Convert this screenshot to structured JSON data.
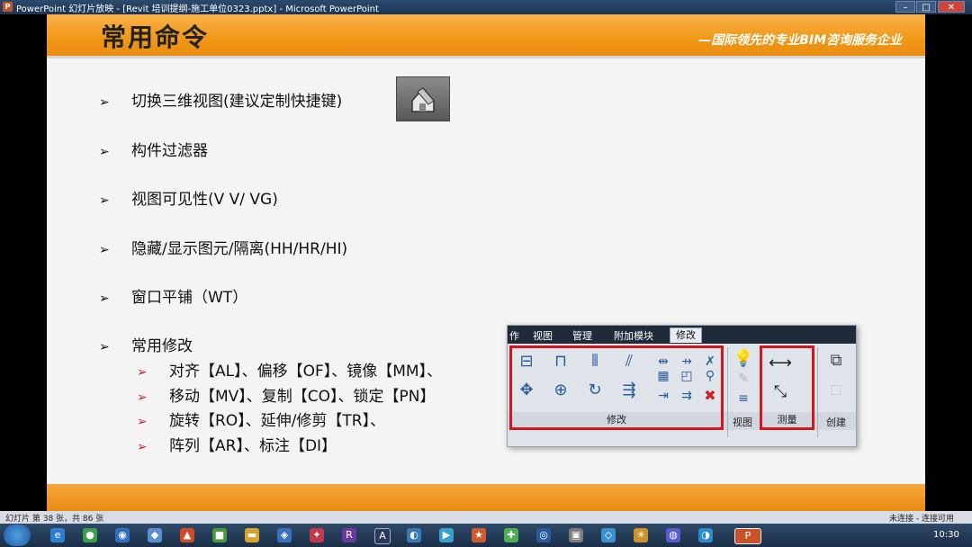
{
  "window": {
    "title": "PowerPoint 幻灯片放映 - [Revit 培训提纲-施工单位0323.pptx] - Microsoft PowerPoint",
    "app_icon_letter": "P"
  },
  "slide": {
    "title": "常用命令",
    "slogan": "—国际领先的专业BIM咨询服务企业",
    "bullets": [
      "切换三维视图(建议定制快捷键)",
      "构件过滤器",
      "视图可见性(V V/ VG)",
      "隐藏/显示图元/隔离(HH/HR/HI)",
      "窗口平铺（WT）",
      "常用修改"
    ],
    "sub_bullets": [
      "对齐【AL】、偏移【OF】、镜像【MM】、",
      "移动【MV】、复制【CO】、锁定【PN】",
      "旋转【RO】、延伸/修剪【TR】、",
      "阵列【AR】、标注【DI】"
    ],
    "bullet_mark": "➢",
    "ribbon": {
      "tabs": [
        "作",
        "视图",
        "管理",
        "附加模块",
        "修改"
      ],
      "groups": [
        "修改",
        "视图",
        "测量",
        "创建"
      ]
    }
  },
  "statusbar": {
    "slide_info": "幻灯片 第 38 张，共 86 张",
    "network": "未连接 - 连接可用"
  },
  "taskbar": {
    "clock": "10:30"
  },
  "colors": {
    "accent_orange": "#f09a1a",
    "highlight_red": "#d2161c"
  }
}
